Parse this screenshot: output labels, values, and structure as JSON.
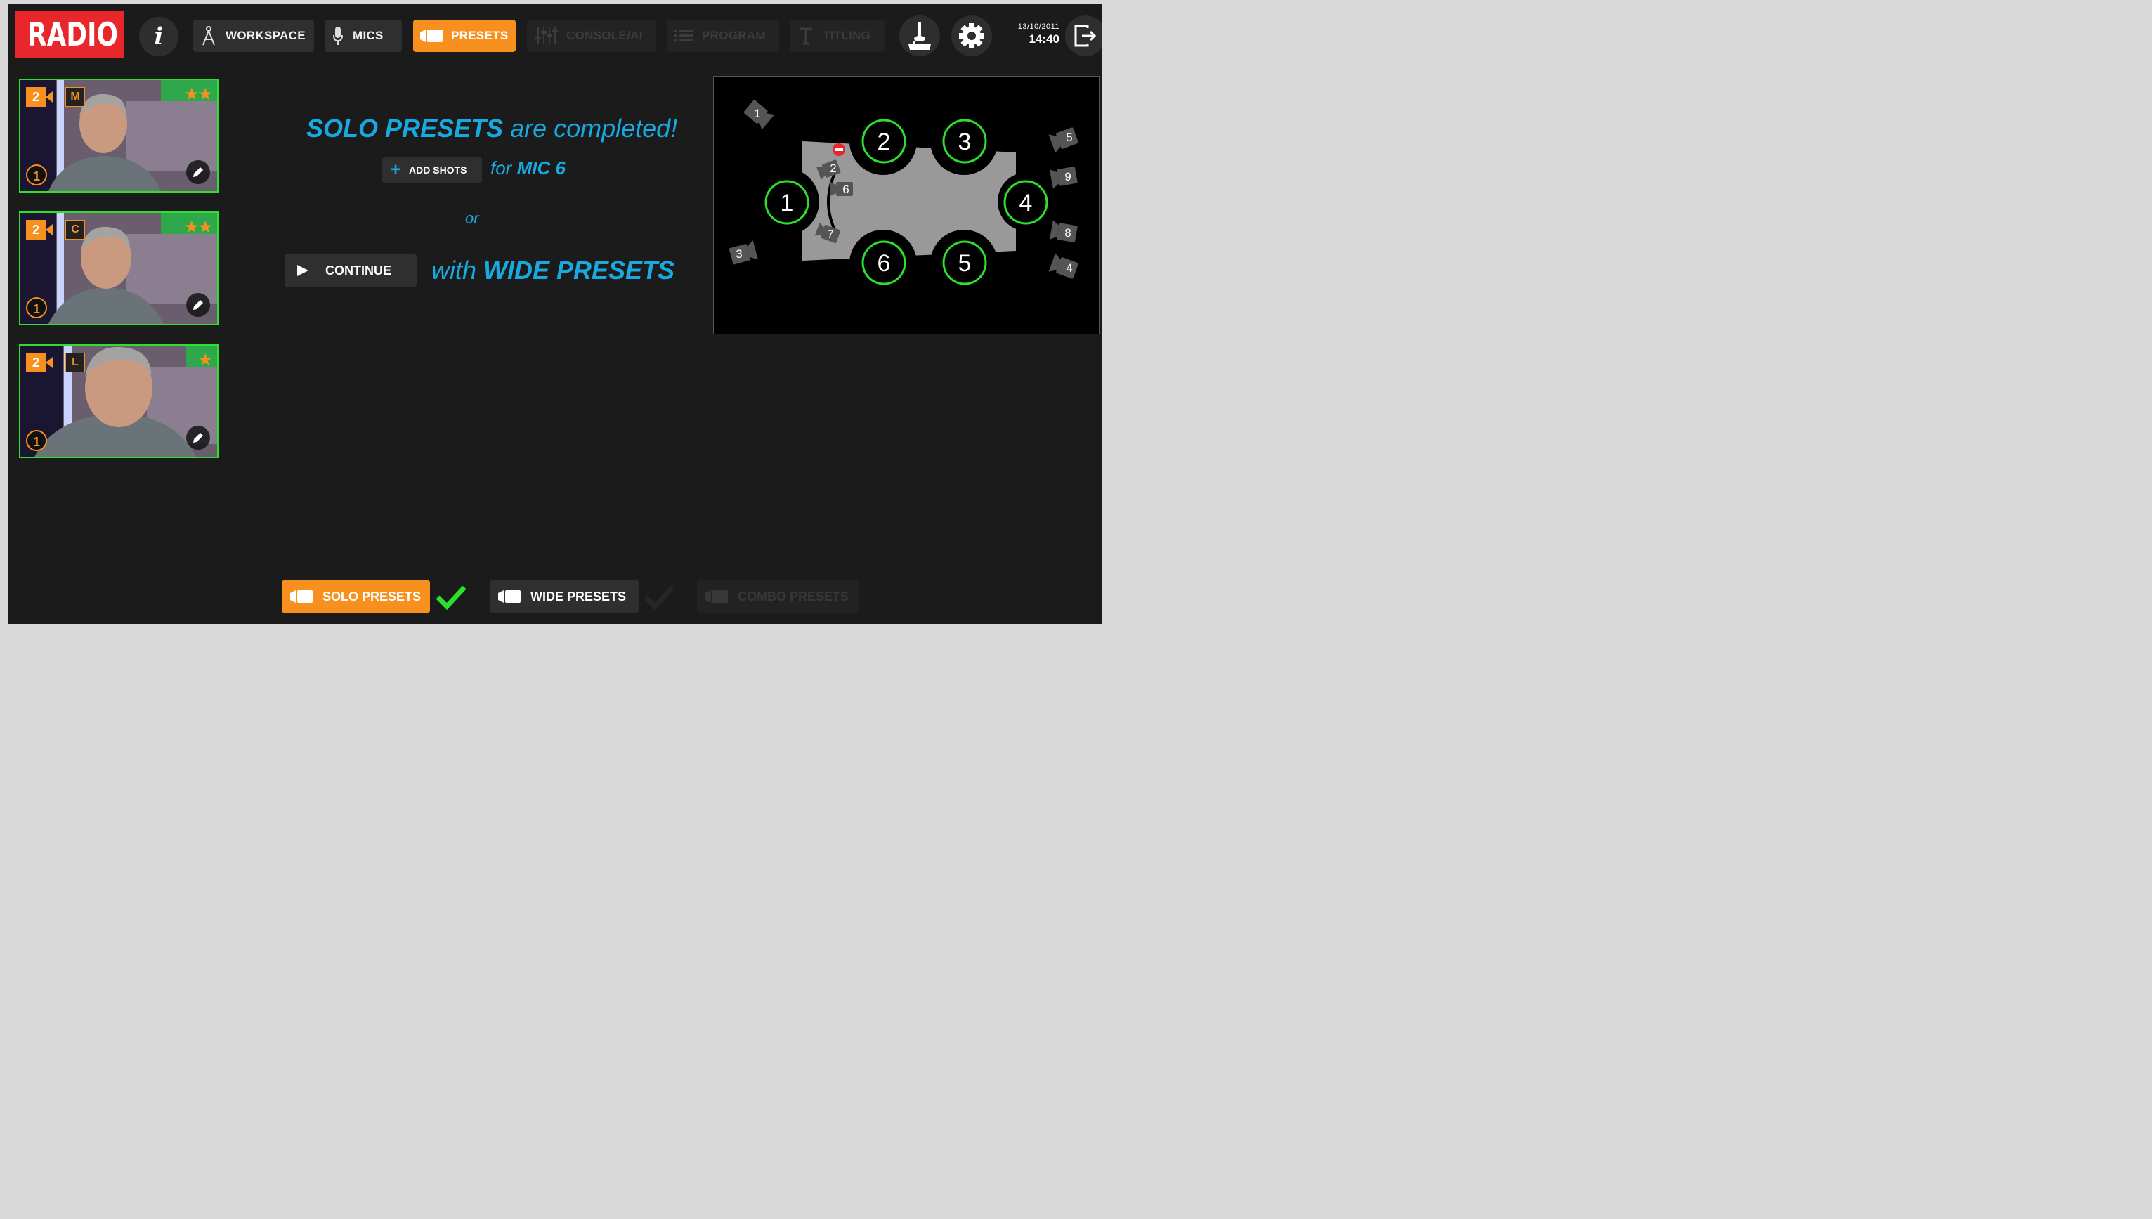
{
  "header": {
    "logo": "RADIO",
    "info_icon": "i",
    "nav": [
      {
        "label": "WORKSPACE",
        "icon": "compass-icon",
        "state": "normal"
      },
      {
        "label": "MICS",
        "icon": "microphone-icon",
        "state": "normal"
      },
      {
        "label": "PRESETS",
        "icon": "camera-icon",
        "state": "active"
      },
      {
        "label": "CONSOLE/AI",
        "icon": "mixer-icon",
        "state": "disabled"
      },
      {
        "label": "PROGRAM",
        "icon": "list-icon",
        "state": "disabled"
      },
      {
        "label": "TITLING",
        "icon": "text-icon",
        "state": "disabled"
      }
    ],
    "date": "13/10/2011",
    "time": "14:40"
  },
  "thumbnails": [
    {
      "number": "2",
      "size": "M",
      "stars": "★★",
      "pin": "1"
    },
    {
      "number": "2",
      "size": "C",
      "stars": "★★",
      "pin": "1"
    },
    {
      "number": "2",
      "size": "L",
      "stars": "★",
      "pin": "1"
    }
  ],
  "message": {
    "headline_bold": "SOLO PRESETS",
    "headline_rest": " are completed!",
    "add_shots": "ADD SHOTS",
    "for_prefix": "for ",
    "for_target": "MIC 6",
    "or": "or",
    "continue": "CONTINUE",
    "with_prefix": "with ",
    "with_target": "WIDE PRESETS"
  },
  "studio_map": {
    "seats": [
      "1",
      "2",
      "3",
      "4",
      "5",
      "6"
    ],
    "cameras": [
      "1",
      "2",
      "3",
      "4",
      "5",
      "6",
      "7",
      "8",
      "9"
    ]
  },
  "bottom_tabs": {
    "solo": "SOLO PRESETS",
    "wide": "WIDE PRESETS",
    "combo": "COMBO PRESETS"
  },
  "colors": {
    "accent": "#f7901e",
    "highlight": "#19a9e1",
    "ok": "#2de02d",
    "logo": "#e8262b"
  }
}
